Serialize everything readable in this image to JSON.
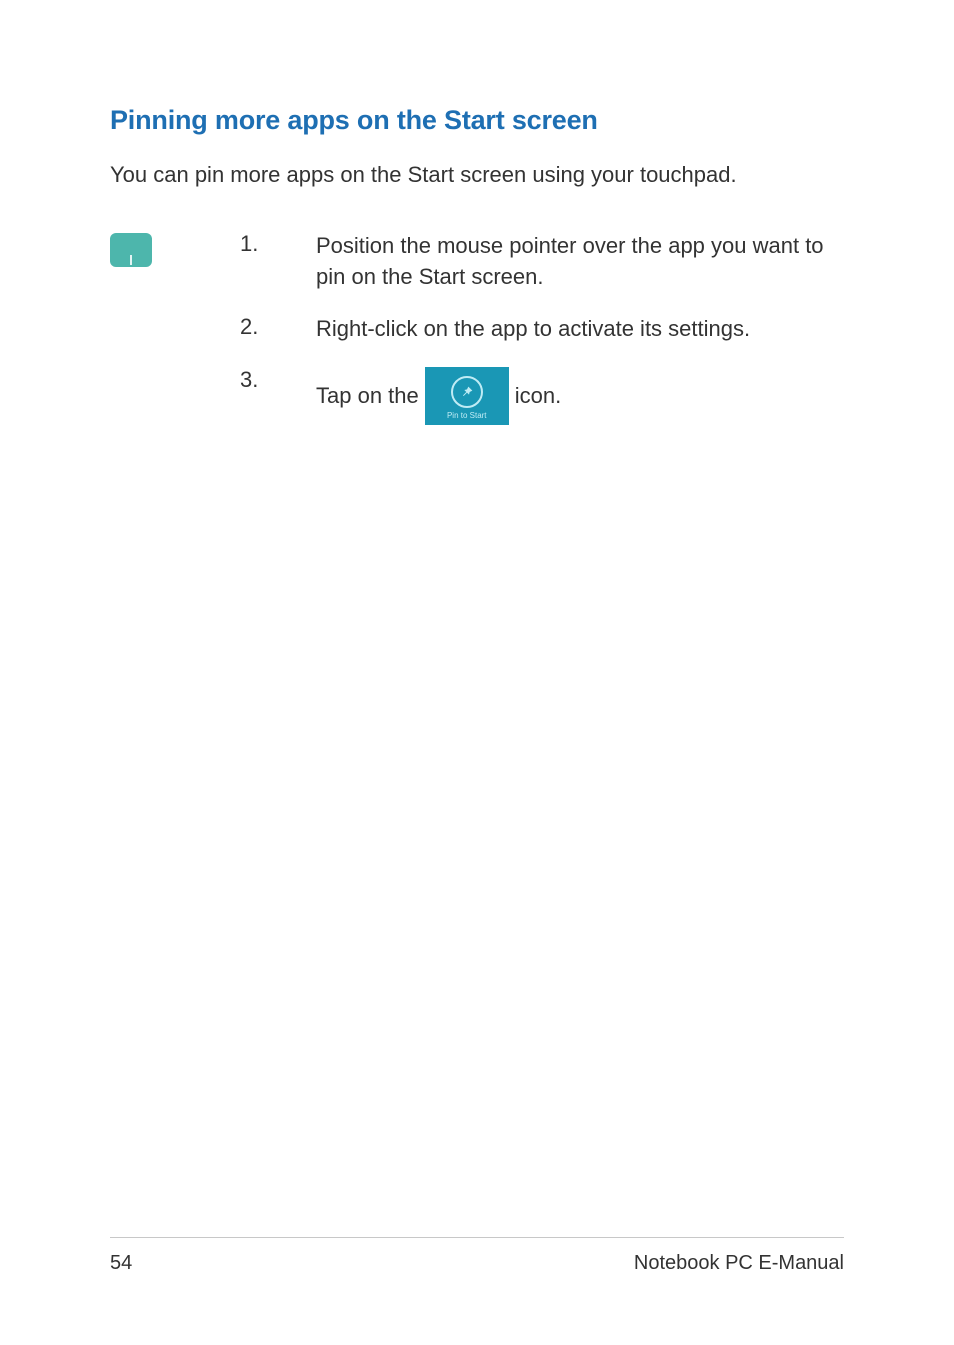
{
  "heading": "Pinning more apps on the Start screen",
  "intro": "You can pin more apps on the Start screen using your touchpad.",
  "steps": [
    {
      "num": "1.",
      "text": "Position the mouse pointer over the app you want to pin on the Start screen."
    },
    {
      "num": "2.",
      "text": "Right-click on the app to activate its settings."
    },
    {
      "num": "3.",
      "pre": "Tap on the",
      "post": "icon."
    }
  ],
  "pin_icon_label": "Pin to Start",
  "footer": {
    "page_number": "54",
    "doc_title": "Notebook PC E-Manual"
  }
}
